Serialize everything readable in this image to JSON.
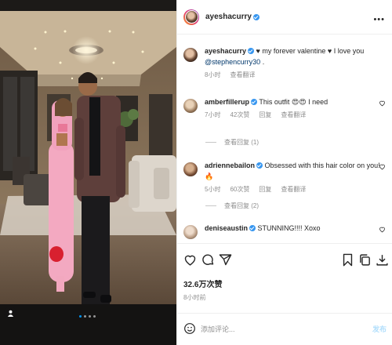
{
  "post": {
    "username": "ayeshacurry",
    "image_alt": "Couple posing in a living room",
    "carousel_count": 4,
    "carousel_active": 1
  },
  "caption": {
    "username": "ayeshacurry",
    "text": " ♥ my forever valentine ♥ I love you ",
    "mention": "@stephencurry30",
    "trail": " .",
    "time": "8小时",
    "translate": "查看翻译"
  },
  "comments": [
    {
      "username": "amberfillerup",
      "text": " This outfit 😍😍 I need",
      "time": "7小时",
      "likes": "42次赞",
      "reply": "回复",
      "translate": "查看翻译",
      "more_replies": "查看回复 (1)"
    },
    {
      "username": "adriennebailon",
      "text": " Obsessed with this hair color on you! 🔥",
      "time": "5小时",
      "likes": "60次赞",
      "reply": "回复",
      "translate": "查看翻译",
      "more_replies": "查看回复 (2)"
    },
    {
      "username": "deniseaustin",
      "text": " STUNNING!!!! Xoxo"
    }
  ],
  "stats": {
    "likes": "32.6万次赞",
    "time": "8小时前"
  },
  "composer": {
    "placeholder": "添加评论...",
    "post_label": "发布"
  },
  "icons": [
    "more-icon",
    "heart-icon",
    "comment-icon",
    "share-icon",
    "bookmark-icon",
    "copy-icon",
    "download-icon",
    "emoji-icon",
    "user-tag-icon",
    "verified-icon"
  ],
  "colors": {
    "verified": "#3897f0",
    "link": "#00376b",
    "muted": "#8e8e8e",
    "post_button": "#b2dffc"
  }
}
